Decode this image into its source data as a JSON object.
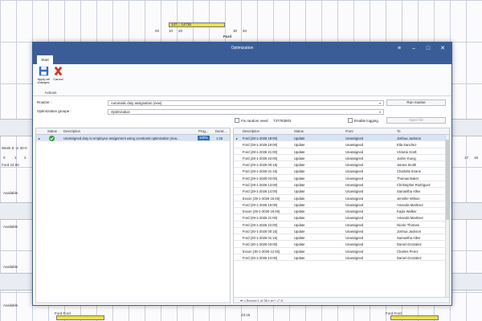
{
  "background": {
    "band_items": [
      {
        "text": "P",
        "kind": "left-letter"
      }
    ],
    "top_marker": "Ford",
    "top_times": [
      "00",
      "10",
      "20",
      "30",
      "40"
    ],
    "top_bar_label": "147... 14736",
    "left_label_1": "Week 5: vr 30-0",
    "left_label_2": "Ford 24:00",
    "left_times": [
      "0",
      "1",
      "2"
    ],
    "available_labels": [
      "Available",
      "Available",
      "Available",
      "Available"
    ],
    "bottom_ford": "Ford Ford",
    "bottom_time": "23:15",
    "right_times": [
      "17",
      "18"
    ],
    "bottom_right": "Ford Ford"
  },
  "dialog": {
    "title": "Optimization",
    "controls": {
      "menu": "≡",
      "minimize": "–",
      "maximize": "□",
      "close": "✕"
    },
    "tab": "Start",
    "ribbon": {
      "apply_label_1": "Apply all",
      "apply_label_2": "changes",
      "cancel_label": "Cancel",
      "group_label": "Actions"
    },
    "routine_label": "Routine :",
    "routine_value": "Automatic duty assignation (new)",
    "run_button": "Run routine",
    "groups_label": "Optimization groupe :",
    "groups_value": "Optimization",
    "fix_seed_label": "Fix random seed",
    "seed_value": "737783503",
    "enable_logging_label": "Enable logging",
    "open_file_button": "Open file",
    "left_grid": {
      "headers": [
        "Status",
        "Description",
        "Prog...",
        "Durat..."
      ],
      "rows": [
        {
          "status": "ok",
          "description": "Unassigned duty to employee assignment using constraint optimization (sea...",
          "progress": "100%",
          "duration": "1:25"
        }
      ]
    },
    "right_grid": {
      "headers": [
        "Description",
        "Status",
        "From",
        "To"
      ],
      "rows": [
        {
          "description": "Ford (28-1-2026 18:00)",
          "status": "Update",
          "from": "Unassigned",
          "to": "Joshua Jackson"
        },
        {
          "description": "Ford (28-1-2026 19:00)",
          "status": "Update",
          "from": "Unassigned",
          "to": "Ella Sanchez"
        },
        {
          "description": "Ford (28-1-2026 21:00)",
          "status": "Update",
          "from": "Unassigned",
          "to": "Victoria Scott"
        },
        {
          "description": "Ford (28-1-2026 22:00)",
          "status": "Update",
          "from": "Unassigned",
          "to": "Justin Young"
        },
        {
          "description": "Ford (29-1-2026 00:15)",
          "status": "Update",
          "from": "Unassigned",
          "to": "James Smith"
        },
        {
          "description": "Ford (29-1-2026 01:15)",
          "status": "Update",
          "from": "Unassigned",
          "to": "Charlotte Evans"
        },
        {
          "description": "Ford (29-1-2026 03:00)",
          "status": "Update",
          "from": "Unassigned",
          "to": "Thomas Baker"
        },
        {
          "description": "Ford (29-1-2026 13:00)",
          "status": "Update",
          "from": "Unassigned",
          "to": "Christopher Rodriguez"
        },
        {
          "description": "Ford (29-1-2026 14:00)",
          "status": "Update",
          "from": "Unassigned",
          "to": "Samantha Allen"
        },
        {
          "description": "Exxon (29-1-2026 16:45)",
          "status": "Update",
          "from": "Unassigned",
          "to": "Jennifer Wilson"
        },
        {
          "description": "Ford (29-1-2026 19:00)",
          "status": "Update",
          "from": "Unassigned",
          "to": "Amanda Martinez"
        },
        {
          "description": "Exxon (29-1-2026 19:45)",
          "status": "Update",
          "from": "Unassigned",
          "to": "Kayla Walker"
        },
        {
          "description": "Ford (29-1-2026 21:00)",
          "status": "Update",
          "from": "Unassigned",
          "to": "Amanda Martinez"
        },
        {
          "description": "Ford (29-1-2026 22:00)",
          "status": "Update",
          "from": "Unassigned",
          "to": "Nicole Thomas"
        },
        {
          "description": "Ford (30-1-2026 00:15)",
          "status": "Update",
          "from": "Unassigned",
          "to": "Joshua Jackson"
        },
        {
          "description": "Ford (30-1-2026 01:15)",
          "status": "Update",
          "from": "Unassigned",
          "to": "Samantha Allen"
        },
        {
          "description": "Ford (30-1-2026 03:00)",
          "status": "Update",
          "from": "Unassigned",
          "to": "Daniel Gonzalez"
        },
        {
          "description": "Exxon (30-1-2026 12:45)",
          "status": "Update",
          "from": "Unassigned",
          "to": "Charles Perez"
        },
        {
          "description": "Ford (30-1-2026 14:00)",
          "status": "Update",
          "from": "Unassigned",
          "to": "Daniel Gonzalez"
        }
      ],
      "footer": "Record 1 of 38"
    }
  }
}
